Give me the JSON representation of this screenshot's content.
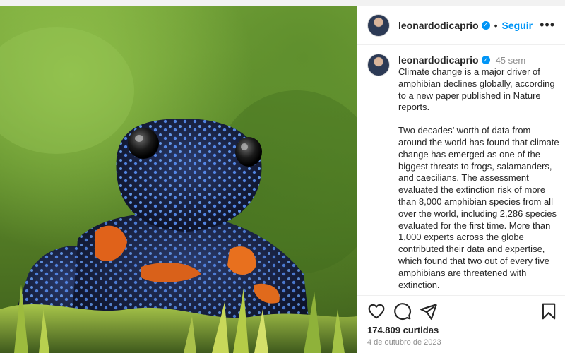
{
  "post": {
    "username": "leonardodicaprio",
    "verified_mark": "✓",
    "separator": "•",
    "follow_label": "Seguir",
    "more_label": "•••",
    "caption_time": "45 sem",
    "caption_paragraphs": [
      "Climate change is a major driver of amphibian declines globally, according to a new paper published in Nature reports.",
      "Two decades’ worth of data from around the world has found that climate change has emerged as one of the biggest threats to frogs, salamanders, and caecilians. The assessment evaluated the extinction risk of more than 8,000 amphibian species from all over the world, including 2,286 species evaluated for the first time. More than 1,000 experts across the globe contributed their data and expertise, which found that two out of every five amphibians are threatened with extinction."
    ],
    "likes": "174.809 curtidas",
    "date": "4 de outubro de 2023"
  },
  "icons": {
    "heart": "heart-icon",
    "comment": "comment-icon",
    "share": "share-icon",
    "bookmark": "bookmark-icon",
    "verified": "verified-badge-icon"
  },
  "colors": {
    "accent": "#0095f6",
    "text": "#262626",
    "muted": "#8e8e8e",
    "divider": "#efefef"
  }
}
